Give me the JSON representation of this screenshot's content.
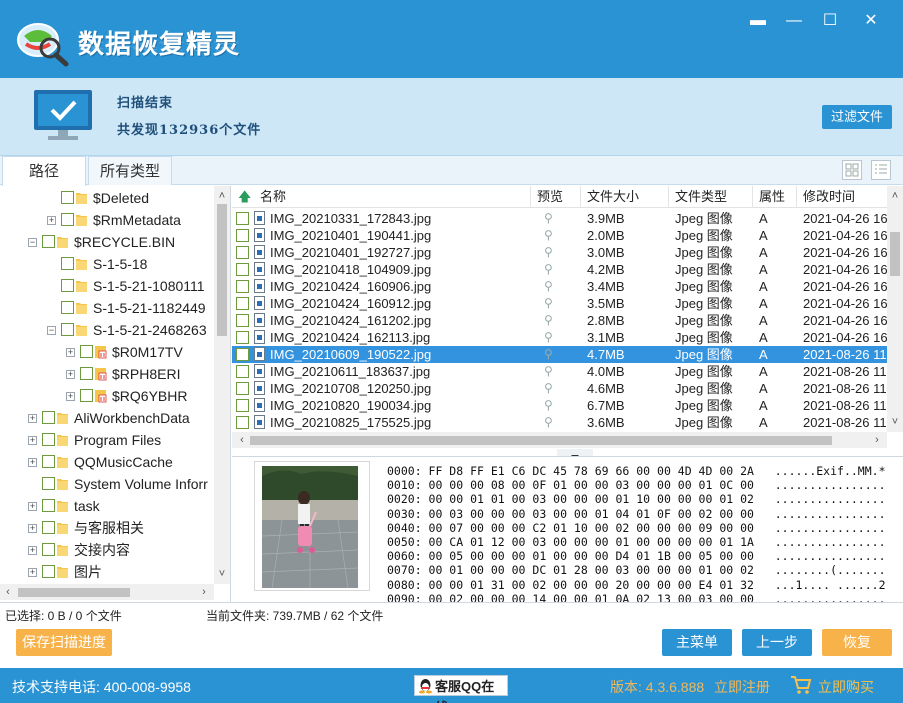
{
  "app": {
    "title": "数据恢复精灵",
    "window_controls": {
      "menu": "▬",
      "minimize": "—",
      "maximize": "☐",
      "close": "✕"
    }
  },
  "status": {
    "title": "扫描结束",
    "count_text": "共发现132936个文件",
    "filter_button": "过滤文件"
  },
  "tabs": {
    "path": "路径",
    "types": "所有类型"
  },
  "tree": {
    "items": [
      {
        "label": "$Deleted",
        "expander": "",
        "folder": "yellow"
      },
      {
        "label": "$RmMetadata",
        "expander": "+",
        "folder": "yellow"
      },
      {
        "label": "$RECYCLE.BIN",
        "expander": "−",
        "folder": "yellow"
      },
      {
        "label": "S-1-5-18",
        "expander": "",
        "folder": "yellow"
      },
      {
        "label": "S-1-5-21-1080111",
        "expander": "",
        "folder": "yellow"
      },
      {
        "label": "S-1-5-21-1182449",
        "expander": "",
        "folder": "yellow"
      },
      {
        "label": "S-1-5-21-2468263",
        "expander": "−",
        "folder": "yellow"
      },
      {
        "label": "$R0M17TV",
        "expander": "+",
        "folder": "deleted"
      },
      {
        "label": "$RPH8ERI",
        "expander": "+",
        "folder": "deleted"
      },
      {
        "label": "$RQ6YBHR",
        "expander": "+",
        "folder": "deleted"
      },
      {
        "label": "AliWorkbenchData",
        "expander": "+",
        "folder": "yellow"
      },
      {
        "label": "Program Files",
        "expander": "+",
        "folder": "yellow"
      },
      {
        "label": "QQMusicCache",
        "expander": "+",
        "folder": "yellow"
      },
      {
        "label": "System Volume Inforr",
        "expander": "",
        "folder": "yellow"
      },
      {
        "label": "task",
        "expander": "+",
        "folder": "yellow"
      },
      {
        "label": "与客服相关",
        "expander": "+",
        "folder": "yellow"
      },
      {
        "label": "交接内容",
        "expander": "+",
        "folder": "yellow"
      },
      {
        "label": "图片",
        "expander": "+",
        "folder": "yellow"
      }
    ]
  },
  "list": {
    "headers": {
      "name": "名称",
      "preview": "预览",
      "size": "文件大小",
      "type": "文件类型",
      "attr": "属性",
      "mtime": "修改时间"
    },
    "rows": [
      {
        "name": "IMG_20210331_172843.jpg",
        "size": "3.9MB",
        "type": "Jpeg 图像",
        "attr": "A",
        "mtime": "2021-04-26 16"
      },
      {
        "name": "IMG_20210401_190441.jpg",
        "size": "2.0MB",
        "type": "Jpeg 图像",
        "attr": "A",
        "mtime": "2021-04-26 16"
      },
      {
        "name": "IMG_20210401_192727.jpg",
        "size": "3.0MB",
        "type": "Jpeg 图像",
        "attr": "A",
        "mtime": "2021-04-26 16"
      },
      {
        "name": "IMG_20210418_104909.jpg",
        "size": "4.2MB",
        "type": "Jpeg 图像",
        "attr": "A",
        "mtime": "2021-04-26 16"
      },
      {
        "name": "IMG_20210424_160906.jpg",
        "size": "3.4MB",
        "type": "Jpeg 图像",
        "attr": "A",
        "mtime": "2021-04-26 16"
      },
      {
        "name": "IMG_20210424_160912.jpg",
        "size": "3.5MB",
        "type": "Jpeg 图像",
        "attr": "A",
        "mtime": "2021-04-26 16"
      },
      {
        "name": "IMG_20210424_161202.jpg",
        "size": "2.8MB",
        "type": "Jpeg 图像",
        "attr": "A",
        "mtime": "2021-04-26 16"
      },
      {
        "name": "IMG_20210424_162113.jpg",
        "size": "3.1MB",
        "type": "Jpeg 图像",
        "attr": "A",
        "mtime": "2021-04-26 16"
      },
      {
        "name": "IMG_20210609_190522.jpg",
        "size": "4.7MB",
        "type": "Jpeg 图像",
        "attr": "A",
        "mtime": "2021-08-26 11",
        "selected": true
      },
      {
        "name": "IMG_20210611_183637.jpg",
        "size": "4.0MB",
        "type": "Jpeg 图像",
        "attr": "A",
        "mtime": "2021-08-26 11"
      },
      {
        "name": "IMG_20210708_120250.jpg",
        "size": "4.6MB",
        "type": "Jpeg 图像",
        "attr": "A",
        "mtime": "2021-08-26 11"
      },
      {
        "name": "IMG_20210820_190034.jpg",
        "size": "6.7MB",
        "type": "Jpeg 图像",
        "attr": "A",
        "mtime": "2021-08-26 11"
      },
      {
        "name": "IMG_20210825_175525.jpg",
        "size": "3.6MB",
        "type": "Jpeg 图像",
        "attr": "A",
        "mtime": "2021-08-26 11"
      }
    ]
  },
  "hex": [
    "0000: FF D8 FF E1 C6 DC 45 78 69 66 00 00 4D 4D 00 2A   ......Exif..MM.*",
    "0010: 00 00 00 08 00 0F 01 00 00 03 00 00 00 01 0C 00   ................",
    "0020: 00 00 01 01 00 03 00 00 00 01 10 00 00 00 01 02   ................",
    "0030: 00 03 00 00 00 03 00 00 01 04 01 0F 00 02 00 00   ................",
    "0040: 00 07 00 00 00 C2 01 10 00 02 00 00 00 09 00 00   ................",
    "0050: 00 CA 01 12 00 03 00 00 00 01 00 00 00 00 01 1A   ................",
    "0060: 00 05 00 00 00 01 00 00 00 D4 01 1B 00 05 00 00   ................",
    "0070: 00 01 00 00 00 DC 01 28 00 03 00 00 00 01 00 02   ........(.......",
    "0080: 00 00 01 31 00 02 00 00 00 20 00 00 00 E4 01 32   ...1.... ......2",
    "0090: 00 02 00 00 00 14 00 00 01 0A 02 13 00 03 00 00   ................"
  ],
  "footer": {
    "selected_info": "已选择: 0 B / 0 个文件",
    "current_info": "当前文件夹: 739.7MB / 62 个文件",
    "save_progress": "保存扫描进度",
    "main_menu": "主菜单",
    "prev_step": "上一步",
    "recover": "恢复"
  },
  "bottom": {
    "support": "技术支持电话: 400-008-9958",
    "qq": "客服QQ在线",
    "version": "版本: 4.3.6.888",
    "register": "立即注册",
    "buy": "立即购买"
  },
  "colors": {
    "brand": "#2a93d4",
    "selection": "#3393df",
    "accent_orange": "#f7b24a"
  }
}
